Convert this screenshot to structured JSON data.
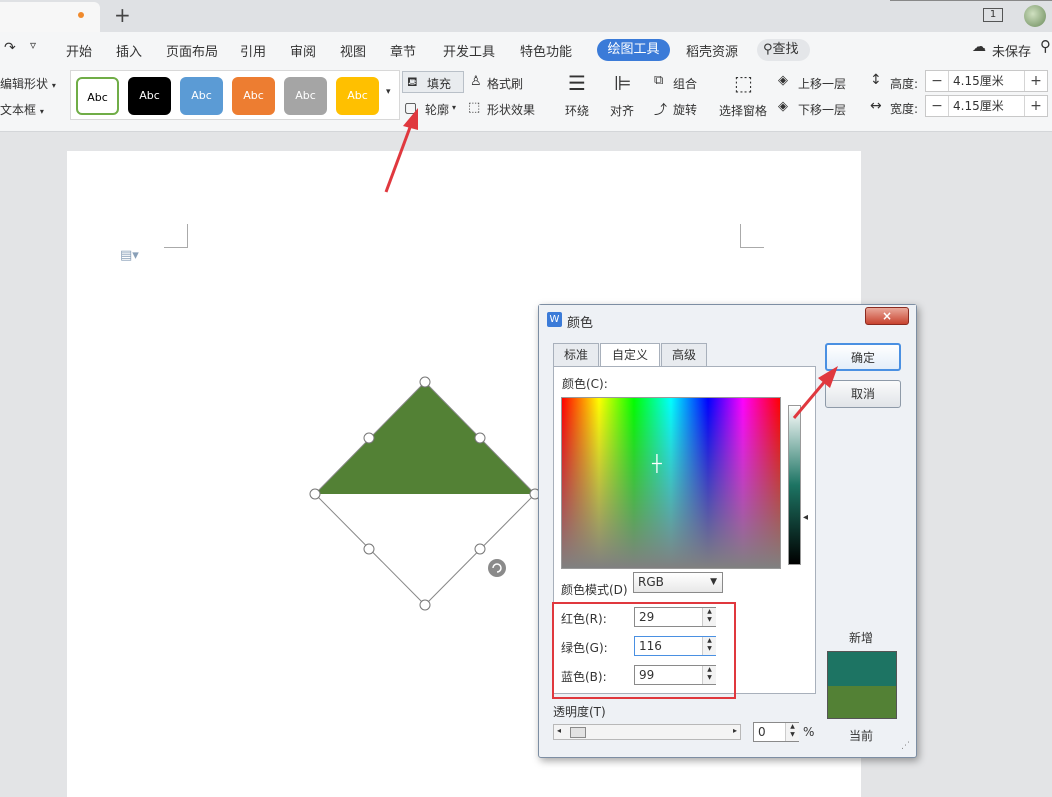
{
  "app": {
    "tab_plus": "+",
    "unsaved_label": "未保存",
    "pages_badge": "1"
  },
  "menu": {
    "items": [
      "开始",
      "插入",
      "页面布局",
      "引用",
      "审阅",
      "视图",
      "章节",
      "开发工具",
      "特色功能"
    ],
    "active": "绘图工具",
    "after": "稻壳资源",
    "search": "查找"
  },
  "ribbon": {
    "edit_shape": "编辑形状",
    "text_box": "文本框",
    "styles": [
      "Abc",
      "Abc",
      "Abc",
      "Abc",
      "Abc",
      "Abc"
    ],
    "style_colors": [
      "#ffffff",
      "#000000",
      "#5b9bd5",
      "#ed7d31",
      "#a5a5a5",
      "#ffc000"
    ],
    "fill": "填充",
    "outline": "轮廓",
    "format_painter": "格式刷",
    "shape_effect": "形状效果",
    "wrap": "环绕",
    "align": "对齐",
    "group": "组合",
    "rotate": "旋转",
    "selection_pane": "选择窗格",
    "bring_forward": "上移一层",
    "send_backward": "下移一层",
    "height_label": "高度:",
    "width_label": "宽度:",
    "height_value": "4.15厘米",
    "width_value": "4.15厘米",
    "minus": "−",
    "plus": "+"
  },
  "document": {
    "shape_fill": "#538135"
  },
  "dialog": {
    "title": "颜色",
    "tabs": [
      "标准",
      "自定义",
      "高级"
    ],
    "ok": "确定",
    "cancel": "取消",
    "close": "×",
    "colors_label": "颜色(C):",
    "mode_label": "颜色模式(D)",
    "mode_value": "RGB",
    "red_label": "红色(R):",
    "green_label": "绿色(G):",
    "blue_label": "蓝色(B):",
    "red": "29",
    "green": "116",
    "blue": "99",
    "transparency_label": "透明度(T)",
    "transparency_value": "0",
    "percent": "%",
    "new_label": "新增",
    "current_label": "当前",
    "new_color": "#1d7463",
    "current_color": "#538135"
  }
}
